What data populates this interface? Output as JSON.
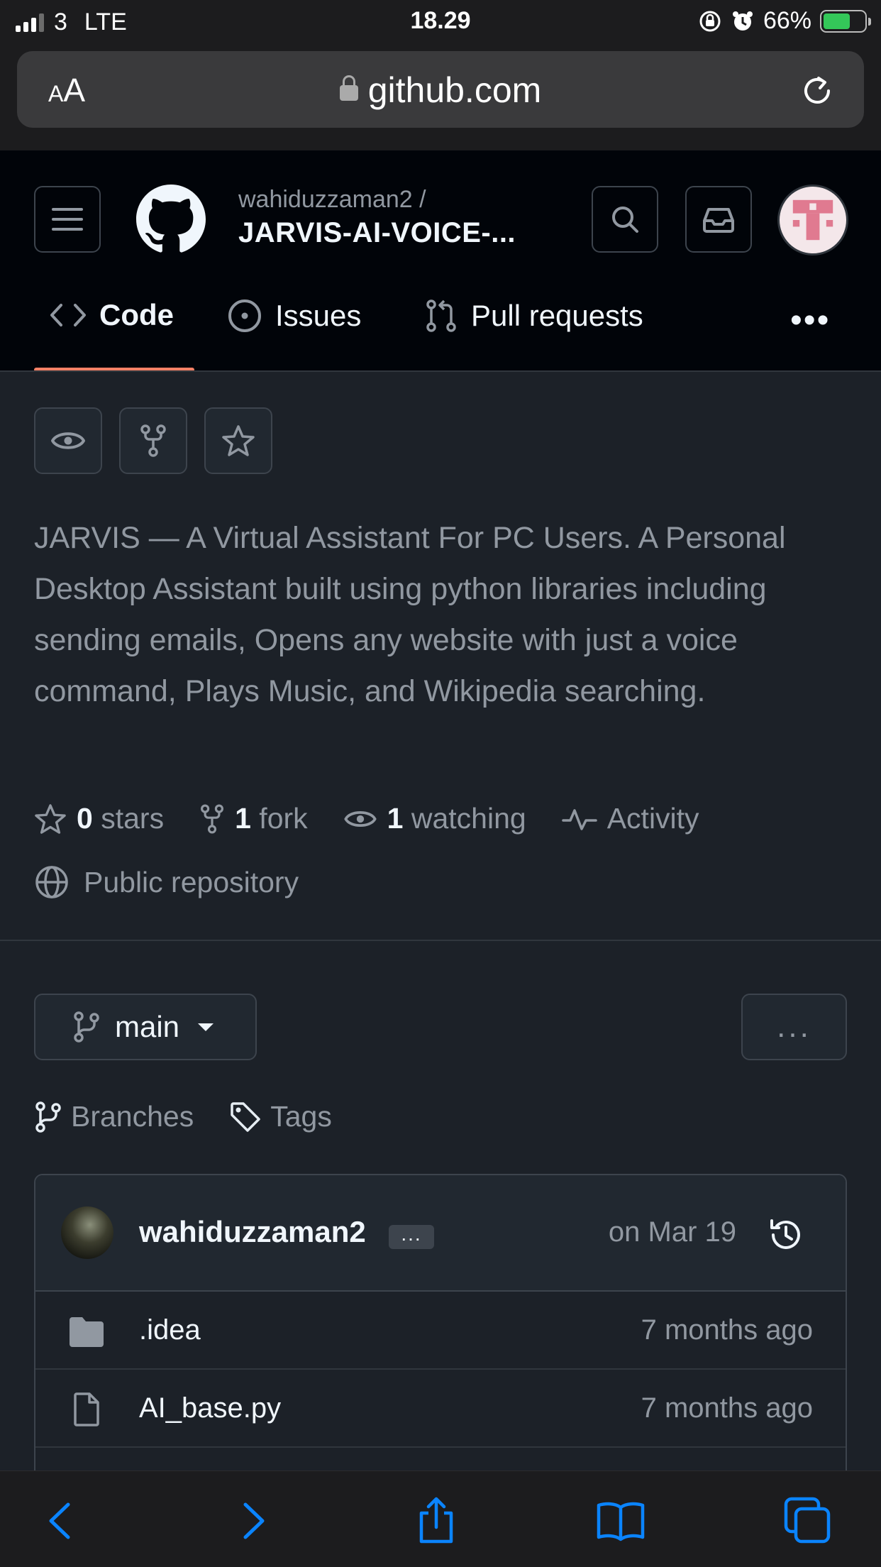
{
  "status_bar": {
    "carrier": "3",
    "network": "LTE",
    "time": "18.29",
    "battery": "66%",
    "battery_level": 0.66
  },
  "browser": {
    "text_size_label": "AA",
    "url": "github.com",
    "icons": [
      "lock-icon",
      "reload-icon"
    ]
  },
  "header": {
    "owner": "wahiduzzaman2 /",
    "repo": "JARVIS-AI-VOICE-..."
  },
  "tabs": [
    {
      "label": "Code",
      "icon": "code-icon",
      "selected": true
    },
    {
      "label": "Issues",
      "icon": "issue-opened-icon"
    },
    {
      "label": "Pull requests",
      "icon": "git-pull-request-icon"
    }
  ],
  "description": "JARVIS — A Virtual Assistant For PC Users. A Personal Desktop Assistant built using python libraries including sending emails, Opens any website with just a voice command, Plays Music, and Wikipedia searching.",
  "stats": {
    "stars_count": "0",
    "stars_label": "stars",
    "forks_count": "1",
    "forks_label": "fork",
    "watching_count": "1",
    "watching_label": "watching",
    "activity_label": "Activity",
    "visibility": "Public repository"
  },
  "branch": {
    "name": "main",
    "more": "..."
  },
  "links": {
    "branches": "Branches",
    "tags": "Tags"
  },
  "latest_commit": {
    "author": "wahiduzzaman2",
    "dots": "...",
    "date": "on Mar 19"
  },
  "files": [
    {
      "name": ".idea",
      "type": "folder",
      "date": "7 months ago"
    },
    {
      "name": "AI_base.py",
      "type": "file",
      "date": "7 months ago"
    }
  ],
  "colors": {
    "background": "#1c2128",
    "header": "#010409",
    "accent_underline": "#f78166",
    "safari_blue": "#0a84ff",
    "battery_green": "#34c759"
  }
}
